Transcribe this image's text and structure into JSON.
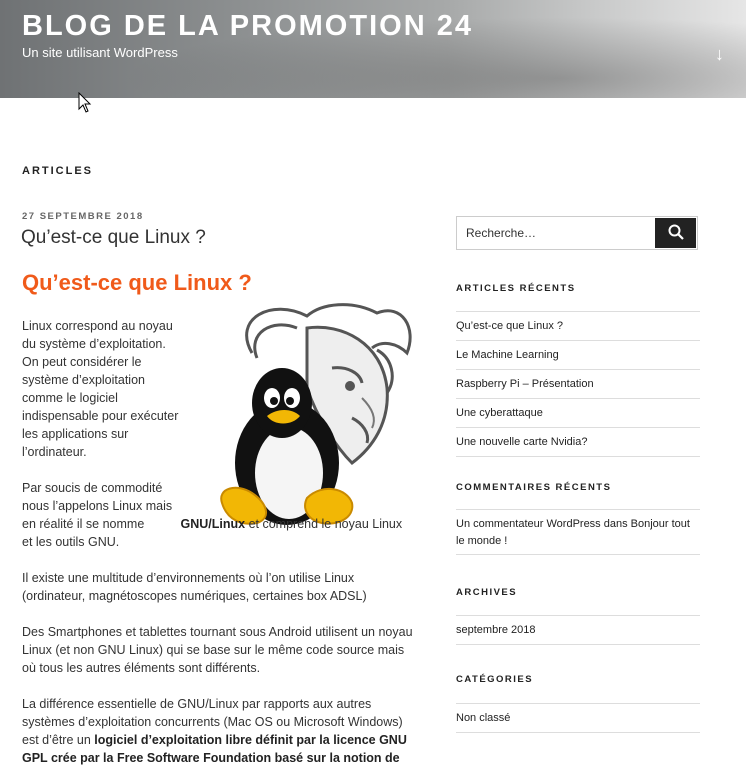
{
  "header": {
    "title": "BLOG DE LA PROMOTION 24",
    "description": "Un site utilisant WordPress",
    "scroll_icon": "arrow-down-icon"
  },
  "main": {
    "section_label": "ARTICLES",
    "post": {
      "date": "27 SEPTEMBRE 2018",
      "title": "Qu’est-ce que Linux ?",
      "heading": "Qu’est-ce que Linux ?",
      "p1": "Linux correspond au noyau du système d’exploitation. On peut considérer le système d’exploitation comme le logiciel indispensable pour exécuter les applications sur l’ordinateur.",
      "p2_a": "Par soucis de commodité nous l’appelons Linux mais en réalité il se nomme",
      "p2_bold": "GNU/Linux",
      "p2_b": "et comprend le noyau Linux et les outils GNU.",
      "p3": "Il existe une multitude d’environnements où l’on utilise Linux (ordinateur, magnétoscopes numériques, certaines box ADSL)",
      "p4": "Des Smartphones et tablettes tournant sous Android utilisent un noyau Linux (et non GNU Linux) qui se base sur le même code source mais où tous les autres éléments sont différents.",
      "p5_a": "La différence essentielle de GNU/Linux par rapports aux autres systèmes d’exploitation concurrents (Mac OS ou Microsoft Windows) est d’être un",
      "p5_bold": "logiciel d’exploitation libre définit par la licence GNU GPL crée par la Free Software Foundation basé sur la notion de"
    }
  },
  "sidebar": {
    "search": {
      "placeholder": "Recherche…",
      "icon": "search-icon"
    },
    "recent_posts": {
      "title": "ARTICLES RÉCENTS",
      "items": [
        "Qu’est-ce que Linux ?",
        "Le Machine Learning",
        "Raspberry Pi – Présentation",
        "Une cyberattaque",
        "Une nouvelle carte Nvidia?"
      ]
    },
    "recent_comments": {
      "title": "COMMENTAIRES RÉCENTS",
      "text": "Un commentateur WordPress dans Bonjour tout le monde !"
    },
    "archives": {
      "title": "ARCHIVES",
      "items": [
        "septembre 2018"
      ]
    },
    "categories": {
      "title": "CATÉGORIES",
      "items": [
        "Non classé"
      ]
    }
  },
  "colors": {
    "accent": "#f05a1a",
    "text": "#222222",
    "button": "#222222"
  }
}
